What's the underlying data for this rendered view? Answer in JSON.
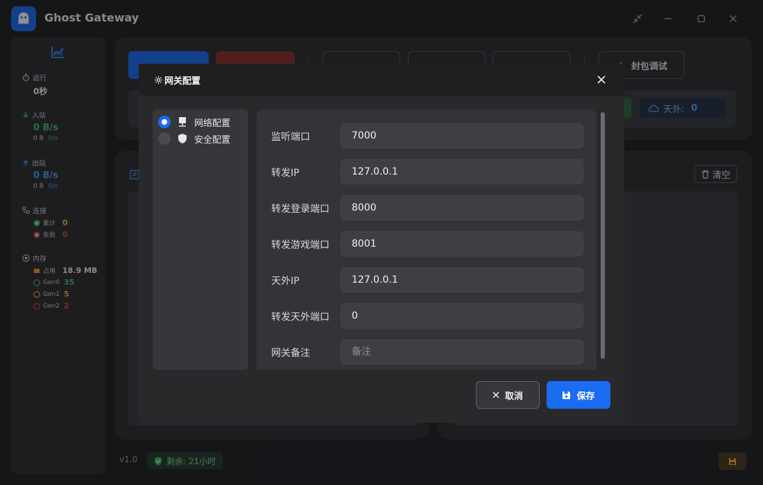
{
  "app": {
    "title": "Ghost Gateway"
  },
  "sidebar": {
    "runtime": {
      "label": "运行",
      "value": "0秒"
    },
    "inbound": {
      "label": "入站",
      "rate": "0 B/s",
      "total": "0 B",
      "sub_rate": "0/s"
    },
    "outbound": {
      "label": "出站",
      "rate": "0 B/s",
      "total": "0 B",
      "sub_rate": "0/s"
    },
    "connections": {
      "label": "连接",
      "total_label": "累计",
      "total_value": "0",
      "failed_label": "失败",
      "failed_value": "0"
    },
    "memory": {
      "label": "内存",
      "used_label": "占用",
      "used_value": "18.9 MB",
      "gen0_label": "Gen0",
      "gen0_value": "35",
      "gen1_label": "Gen1",
      "gen1_value": "5",
      "gen2_label": "Gen2",
      "gen2_value": "2"
    }
  },
  "toolbar": {
    "debug_label": "封包调试"
  },
  "stats": {
    "tianwai_label": "天外:",
    "tianwai_value": "0"
  },
  "log": {
    "clear_label": "清空"
  },
  "footer": {
    "version": "v1.0",
    "remaining": "剩余: 21小时"
  },
  "modal": {
    "title": "网关配置",
    "nav": [
      {
        "label": "网络配置",
        "selected": true
      },
      {
        "label": "安全配置",
        "selected": false
      }
    ],
    "fields": [
      {
        "label": "监听端口",
        "value": "7000",
        "placeholder": ""
      },
      {
        "label": "转发IP",
        "value": "127.0.0.1",
        "placeholder": ""
      },
      {
        "label": "转发登录端口",
        "value": "8000",
        "placeholder": ""
      },
      {
        "label": "转发游戏端口",
        "value": "8001",
        "placeholder": ""
      },
      {
        "label": "天外IP",
        "value": "127.0.0.1",
        "placeholder": ""
      },
      {
        "label": "转发天外端口",
        "value": "0",
        "placeholder": ""
      },
      {
        "label": "网关备注",
        "value": "",
        "placeholder": "备注"
      }
    ],
    "cancel_label": "取消",
    "save_label": "保存"
  },
  "colors": {
    "accent": "#1a6cf0",
    "success": "#45c06a",
    "danger": "#e5483e",
    "warning": "#f0b429",
    "info": "#4a9cff"
  },
  "icons": {
    "logo": "ghost-icon",
    "sidebar_chart": "chart-area-icon",
    "runtime": "stopwatch-icon",
    "inbound": "arrow-down-icon",
    "outbound": "arrow-up-icon",
    "connections": "network-icon",
    "memory": "memory-icon",
    "modal_title": "gear-icon",
    "nav_network": "server-icon",
    "nav_security": "shield-icon",
    "cloud": "cloud-icon",
    "trash": "trash-icon",
    "cancel": "close-icon",
    "save": "floppy-icon"
  }
}
